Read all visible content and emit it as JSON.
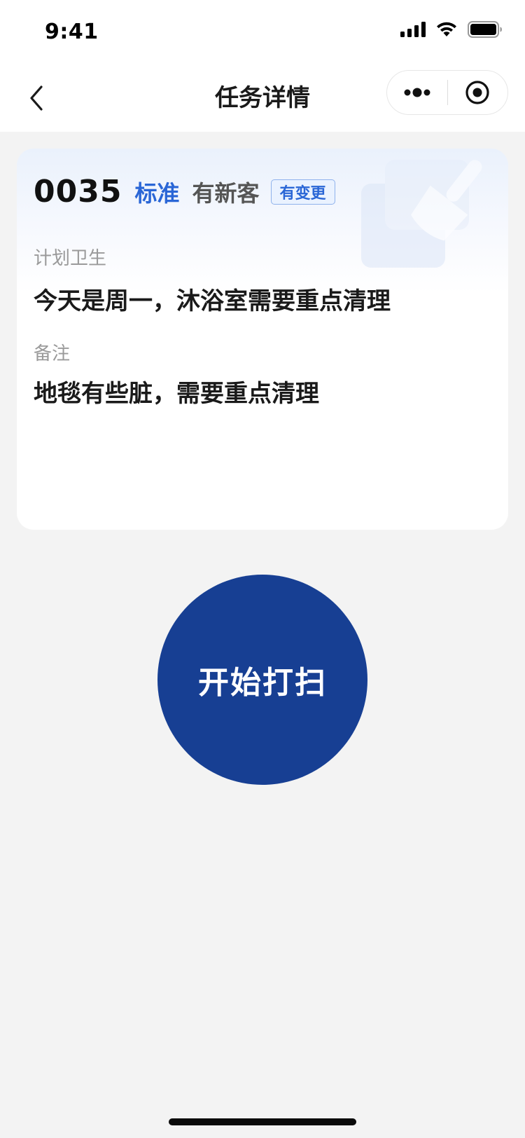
{
  "status_bar": {
    "time": "9:41",
    "icons": [
      "signal-icon",
      "wifi-icon",
      "battery-icon"
    ]
  },
  "nav": {
    "title": "任务详情",
    "back_icon": "chevron-left-icon",
    "capsule_icons": [
      "more-icon",
      "target-icon"
    ]
  },
  "task": {
    "room_number": "0035",
    "room_type": "标准",
    "guest_status": "有新客",
    "change_badge": "有变更",
    "plan_label": "计划卫生",
    "plan_value": "今天是周一，沐浴室需要重点清理",
    "note_label": "备注",
    "note_value": "地毯有些脏，需要重点清理"
  },
  "start_button": {
    "label": "开始打扫"
  },
  "colors": {
    "primary": "#173f93",
    "accent_blue": "#2a66d6",
    "background": "#f3f3f3",
    "card": "#ffffff"
  }
}
